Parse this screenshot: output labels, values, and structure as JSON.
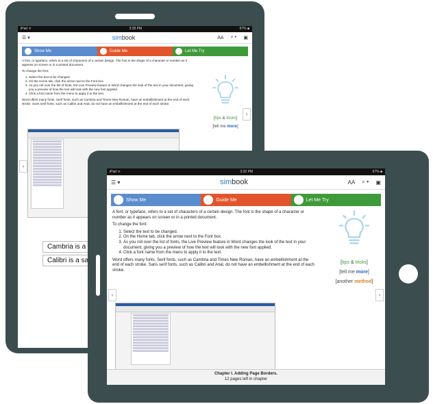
{
  "back_tablet": {
    "status": {
      "carrier": "iPad ᯤ",
      "time": "3:28 PM",
      "battery": "67% ■"
    },
    "toolbar": {
      "logo_prefix": "sim",
      "logo": "book",
      "font_btn": "AA",
      "search": "⌕ ▾"
    },
    "steps": [
      "Show Me",
      "Guide Me",
      "Let Me Try"
    ],
    "intro": "A font, or typeface, refers to a set of characters of a certain design. The font is the shape of a character or number as it appears on screen or in a printed document.",
    "change_heading": "To change the font:",
    "steps_list": [
      "Select the text to be changed.",
      "On the Home tab, click the arrow next to the Font box.",
      "As you roll over the list of fonts, the Live Preview feature in Word changes the look of the text in your document, giving you a preview of how the text will look with the new font applied.",
      "Click a font name from the menu to apply it to the text."
    ],
    "note": "Word offers many fonts. Serif fonts, such as Cambria and Times New Roman, have an embellishment at the end of each stroke. Sans serif fonts, such as Calibri and Arial, do not have an embellishment at the end of each stroke.",
    "tips": {
      "left_bracket": "[",
      "tips_word": "tips",
      "amp": " & ",
      "tricks_word": "tricks",
      "right_bracket": "]"
    },
    "tell": {
      "prefix": "[tell me ",
      "more": "more",
      "suffix": "]"
    },
    "font_sample_1": "Cambria is a",
    "font_sample_2": "Calibri is a sa"
  },
  "front_tablet": {
    "status": {
      "carrier": "iPad ᯤ",
      "time": "3:32 PM",
      "battery": "67% ■"
    },
    "toolbar": {
      "logo_prefix": "sim",
      "logo": "book",
      "font_btn": "AA",
      "search": "⌕ ▾"
    },
    "steps": [
      "Show Me",
      "Guide Me",
      "Let Me Try"
    ],
    "intro": "A font, or typeface, refers to a set of characters of a certain design. The font is the shape of a character or number as it appears on screen or in a printed document.",
    "change_heading": "To change the font:",
    "steps_list": [
      "Select the text to be changed.",
      "On the Home tab, click the arrow next to the Font box.",
      "As you roll over the list of fonts, the Live Preview feature in Word changes the look of the text in your document, giving you a preview of how the text will look with the new font applied.",
      "Click a font name from the menu to apply it to the text."
    ],
    "note": "Word offers many fonts. Serif fonts, such as Cambria and Times New Roman, have an embellishment at the end of each stroke. Sans serif fonts, such as Calibri and Arial, do not have an embellishment at the end of each stroke.",
    "tips": {
      "left_bracket": "[",
      "tips_word": "tips",
      "amp": " & ",
      "tricks_word": "tricks",
      "right_bracket": "]"
    },
    "tell": {
      "prefix": "[tell me ",
      "more": "more",
      "suffix": "]"
    },
    "another": {
      "prefix": "[another ",
      "method": "method",
      "suffix": "]"
    },
    "footer_title": "Chapter I. Adding Page Borders.",
    "footer_sub": "12 pages left in chapter"
  },
  "colors": {
    "frame": "#3c4d4f",
    "show_me": "#5b8ccd",
    "guide_me": "#e2552c",
    "let_me_try": "#3f9a3a"
  }
}
